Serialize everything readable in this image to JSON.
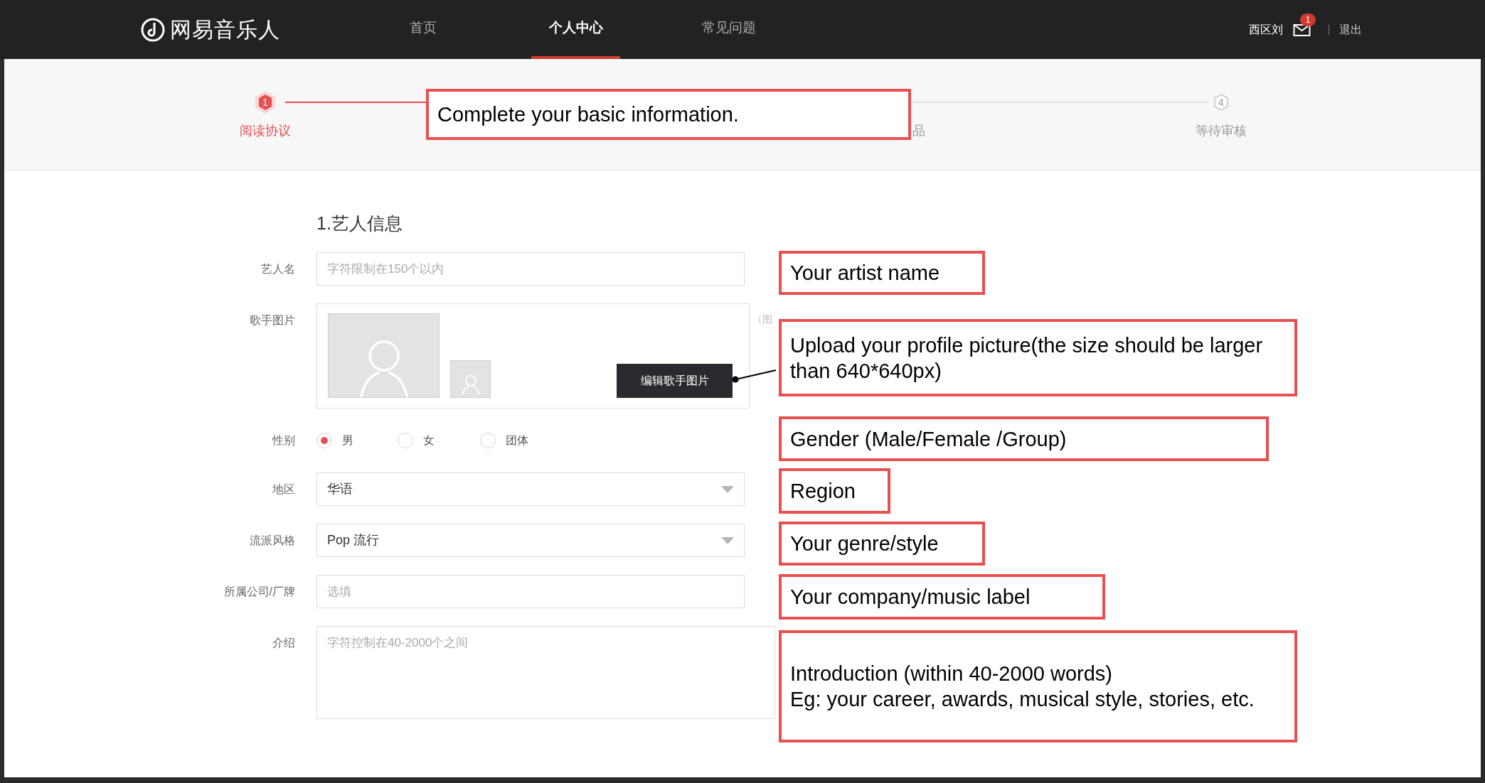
{
  "nav": {
    "logo": "网易音乐人",
    "items": [
      {
        "label": "首页",
        "selected": false
      },
      {
        "label": "个人中心",
        "selected": true
      },
      {
        "label": "常见问题",
        "selected": false
      }
    ],
    "user": "西区刘",
    "mail_badge": "1",
    "logout": "退出"
  },
  "steps": [
    {
      "number": "1",
      "label": "阅读协议",
      "active": true
    },
    {
      "label": "品",
      "active": false
    },
    {
      "number": "4",
      "label": "等待审核",
      "active": false
    }
  ],
  "section_title": "1.艺人信息",
  "fields": [
    {
      "kind": "text",
      "label": "艺人名",
      "placeholder": "字符限制在150个以内"
    },
    {
      "kind": "image",
      "label": "歌手图片",
      "button": "编辑歌手图片",
      "hint": "（图"
    },
    {
      "kind": "radio",
      "label": "性别",
      "options": [
        {
          "label": "男",
          "selected": true
        },
        {
          "label": "女",
          "selected": false
        },
        {
          "label": "团体",
          "selected": false
        }
      ]
    },
    {
      "kind": "select",
      "label": "地区",
      "value": "华语"
    },
    {
      "kind": "select",
      "label": "流派风格",
      "value": "Pop 流行"
    },
    {
      "kind": "text",
      "label": "所属公司/厂牌",
      "placeholder": "选填"
    },
    {
      "kind": "textarea",
      "label": "介绍",
      "placeholder": "字符控制在40-2000个之间"
    }
  ],
  "annotations": [
    {
      "text": "Complete your basic information.",
      "pointer": false
    },
    {
      "text": "Your artist name",
      "pointer": false
    },
    {
      "text": "Upload your profile picture(the size should be larger than 640*640px)",
      "pointer": true
    },
    {
      "text": "Gender (Male/Female /Group)",
      "pointer": false
    },
    {
      "text": "Region",
      "pointer": false
    },
    {
      "text": "Your genre/style",
      "pointer": false
    },
    {
      "text": "Your company/music label",
      "pointer": false
    },
    {
      "text": "Introduction (within 40-2000 words)\nEg: your career, awards, musical style, stories, etc.",
      "pointer": false
    }
  ]
}
